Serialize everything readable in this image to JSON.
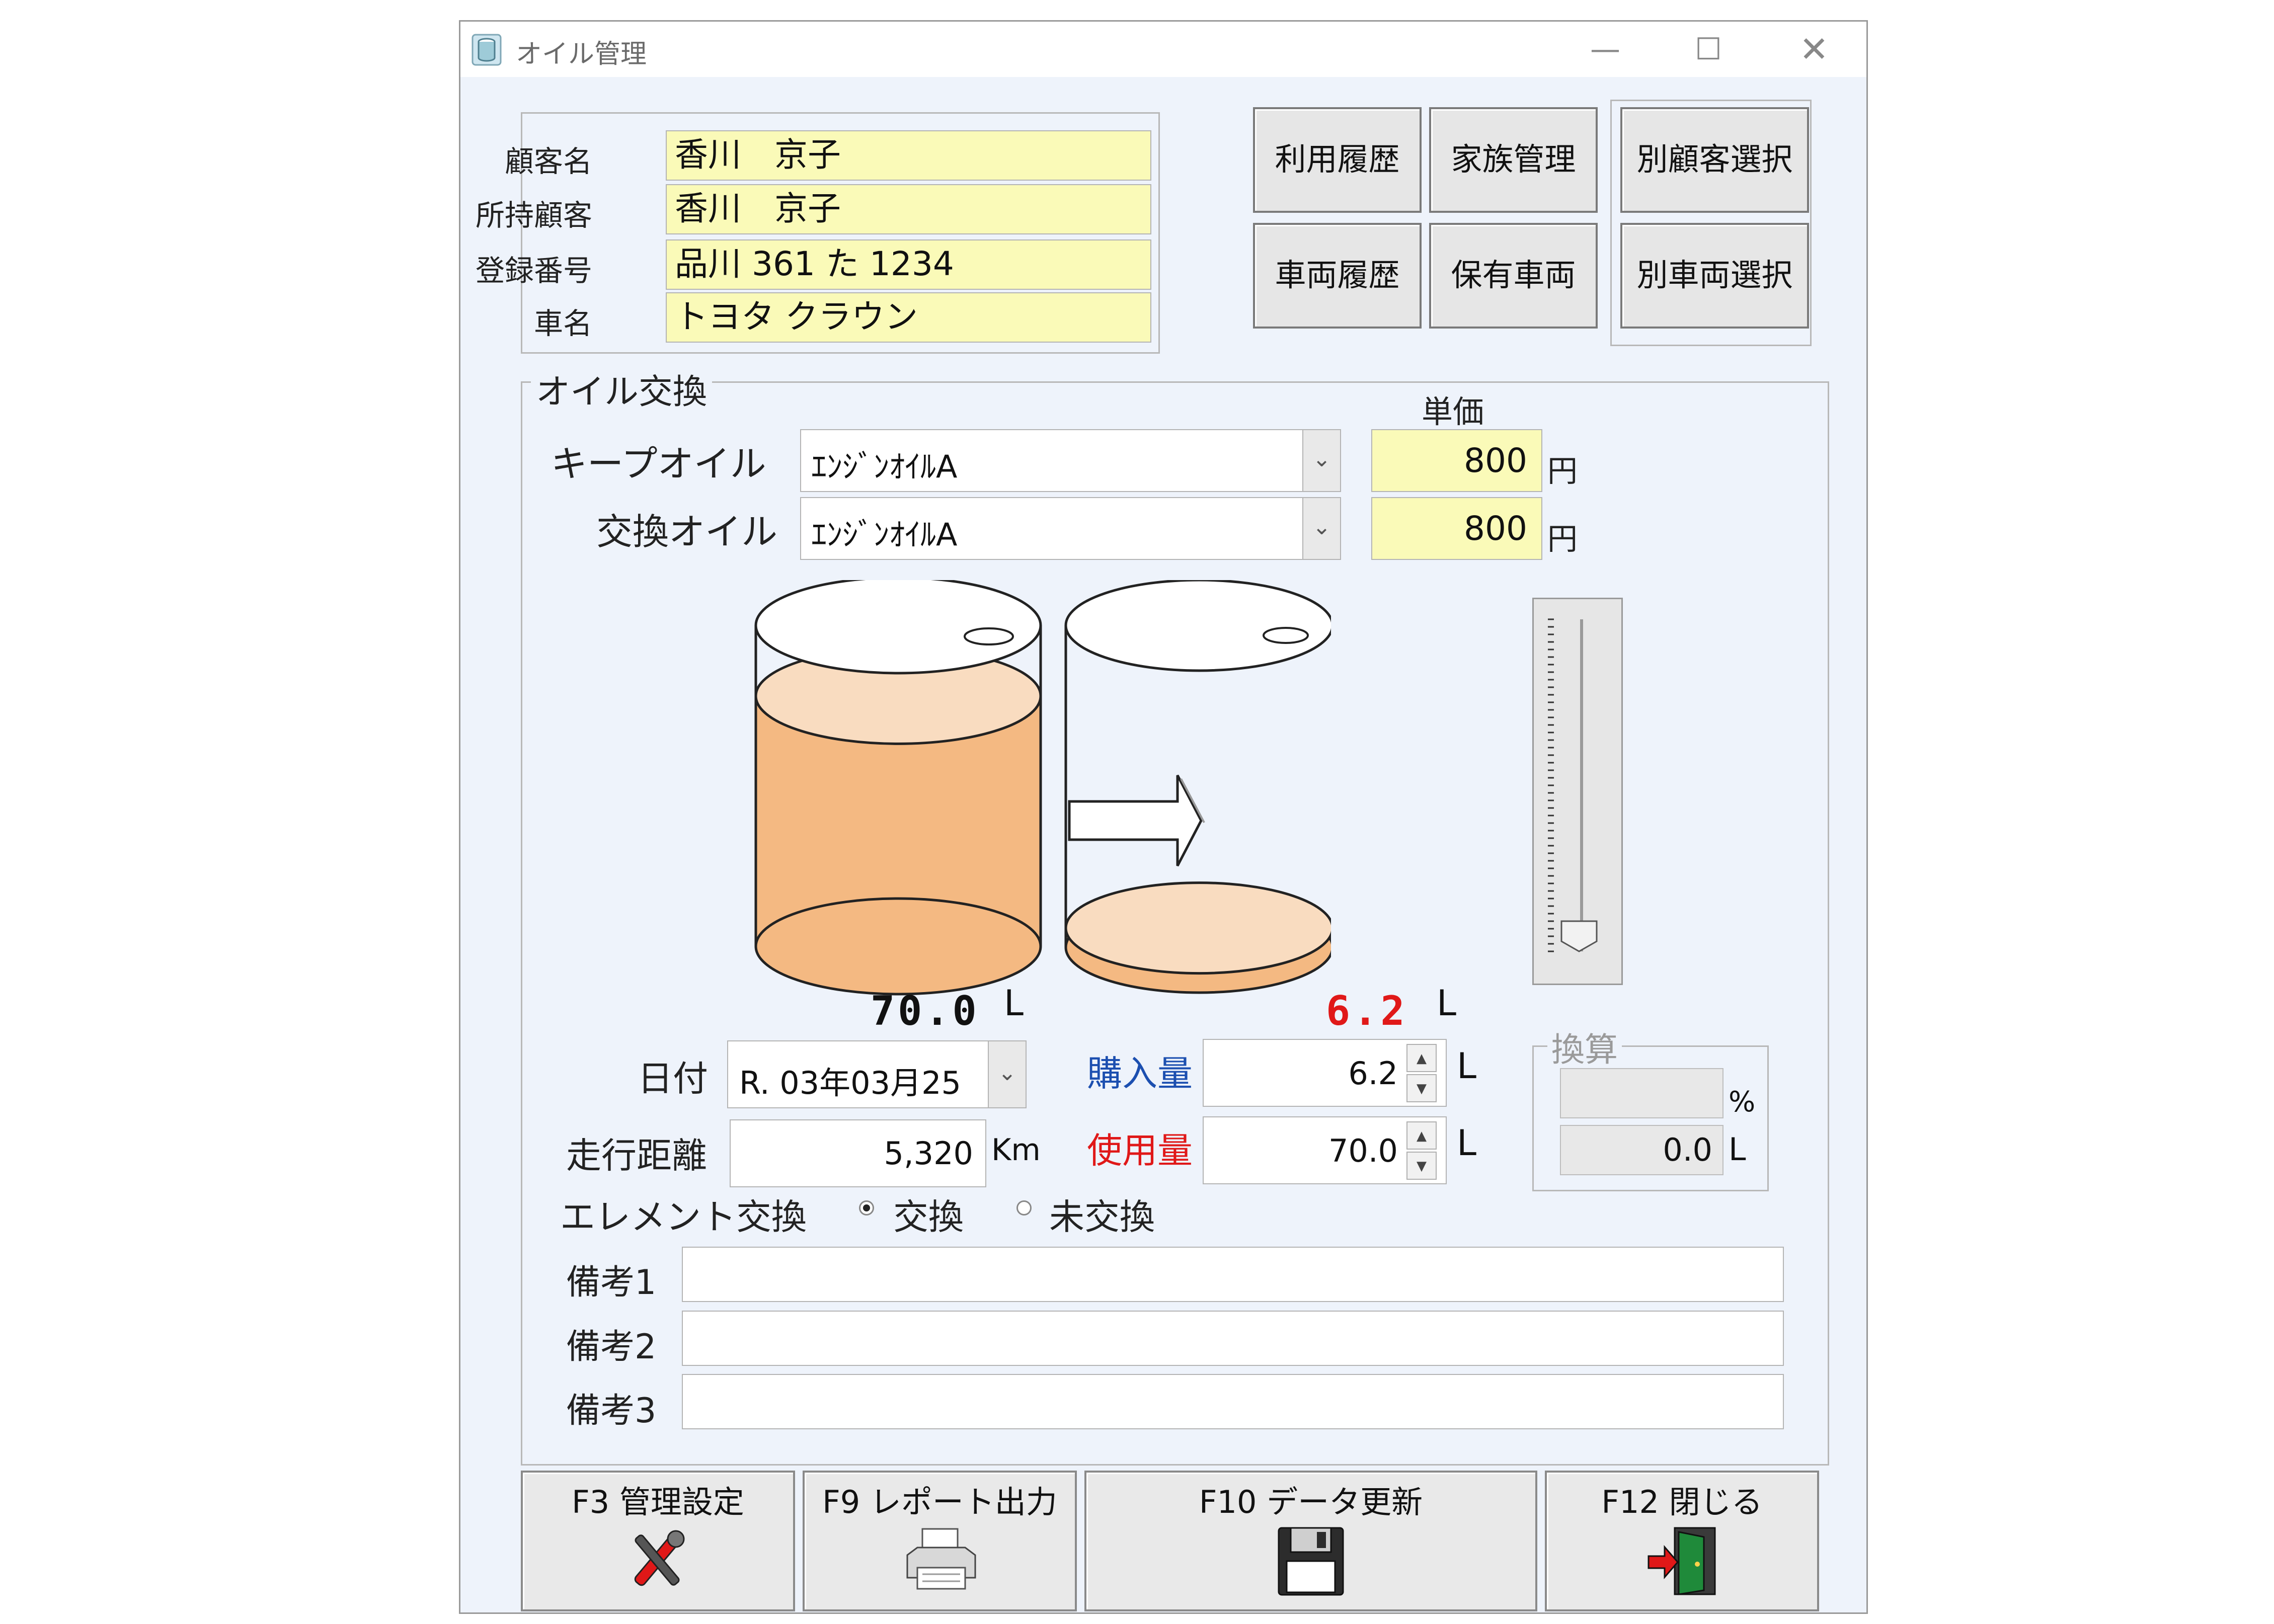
{
  "window": {
    "title": "オイル管理"
  },
  "customer": {
    "name_label": "顧客名",
    "name": "香川　京子",
    "owner_label": "所持顧客",
    "owner": "香川　京子",
    "reg_label": "登録番号",
    "reg": "品川 361 た 1234",
    "car_label": "車名",
    "car": "トヨタ クラウン"
  },
  "buttons": {
    "usage_history": "利用履歴",
    "family": "家族管理",
    "select_customer": "別顧客選択",
    "vehicle_history": "車両履歴",
    "owned_vehicles": "保有車両",
    "select_vehicle": "別車両選択"
  },
  "oil": {
    "group_title": "オイル交換",
    "unit_price_label": "単価",
    "keep_label": "キープオイル",
    "keep_value": "ｴﾝｼﾞﾝｵｲﾙA",
    "keep_price": "800",
    "exchange_label": "交換オイル",
    "exchange_value": "ｴﾝｼﾞﾝｵｲﾙA",
    "exchange_price": "800",
    "yen": "円",
    "left_amount": "70.0",
    "right_amount": "6.2",
    "liter": "L",
    "left_fill": 0.78,
    "right_fill": 0.06,
    "slider_value": 0.0
  },
  "form": {
    "date_label": "日付",
    "date_value": "R. 03年03月25",
    "mileage_label": "走行距離",
    "mileage_value": "5,320",
    "km": "Km",
    "purchase_label": "購入量",
    "purchase_value": "6.2",
    "usage_label": "使用量",
    "usage_value": "70.0",
    "element_label": "エレメント交換",
    "radio_exchange": "交換",
    "radio_none": "未交換",
    "radio_selected": "exchange",
    "note1_label": "備考1",
    "note2_label": "備考2",
    "note3_label": "備考3",
    "note1": "",
    "note2": "",
    "note3": ""
  },
  "conversion": {
    "title": "換算",
    "percent_value": "",
    "percent_unit": "%",
    "liter_value": "0.0",
    "liter_unit": "L"
  },
  "fkeys": {
    "f3": "F3 管理設定",
    "f9": "F9 レポート出力",
    "f10": "F10 データ更新",
    "f12": "F12 閉じる"
  },
  "colors": {
    "field_yellow": "#fafab8",
    "oil_orange": "#f4b982",
    "oil_top": "#f9dcc0",
    "purchase_blue": "#1c4fb0",
    "usage_red": "#e01818"
  },
  "icons": [
    "cylinder-app-icon",
    "tools-icon",
    "printer-icon",
    "floppy-disk-icon",
    "exit-door-icon",
    "arrow-right-icon"
  ]
}
